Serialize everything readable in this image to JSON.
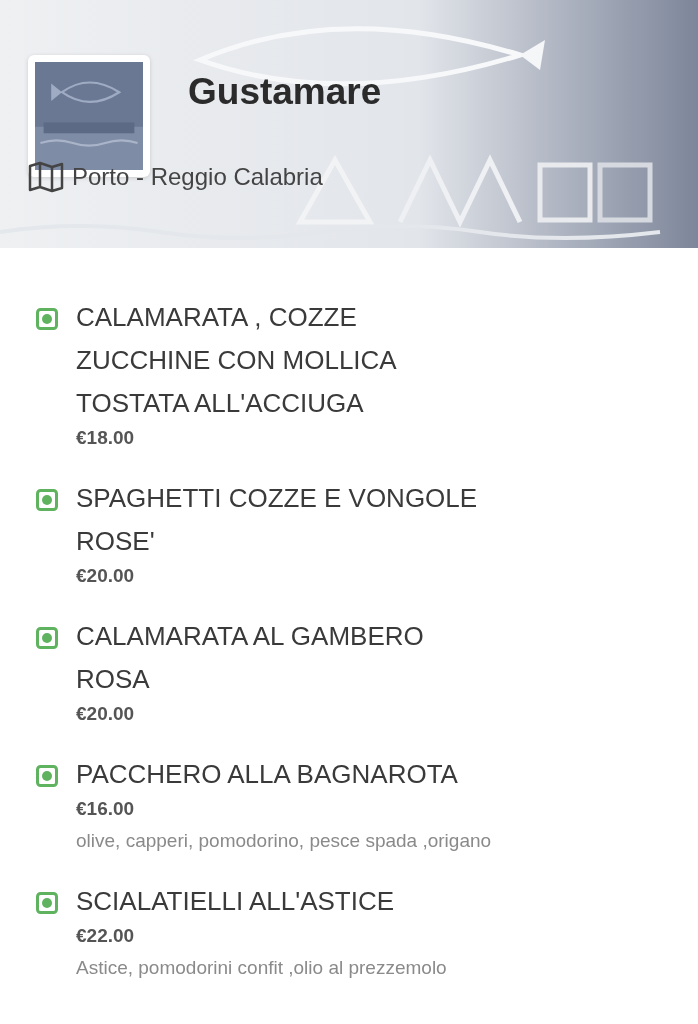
{
  "restaurant": {
    "name": "Gustamare",
    "location": "Porto - Reggio Calabria"
  },
  "menu_items": [
    {
      "name": "CALAMARATA , COZZE ZUCCHINE CON MOLLICA TOSTATA ALL'ACCIUGA",
      "price": "€18.00"
    },
    {
      "name": "SPAGHETTI COZZE E VONGOLE ROSE'",
      "price": "€20.00"
    },
    {
      "name": "CALAMARATA AL GAMBERO ROSA",
      "price": "€20.00"
    },
    {
      "name": "PACCHERO ALLA BAGNAROTA",
      "price": "€16.00",
      "description": "olive, capperi, pomodorino, pesce spada ,origano"
    },
    {
      "name": "SCIALATIELLI ALL'ASTICE",
      "price": "€22.00",
      "description": "Astice, pomodorini confit ,olio al prezzemolo"
    }
  ]
}
